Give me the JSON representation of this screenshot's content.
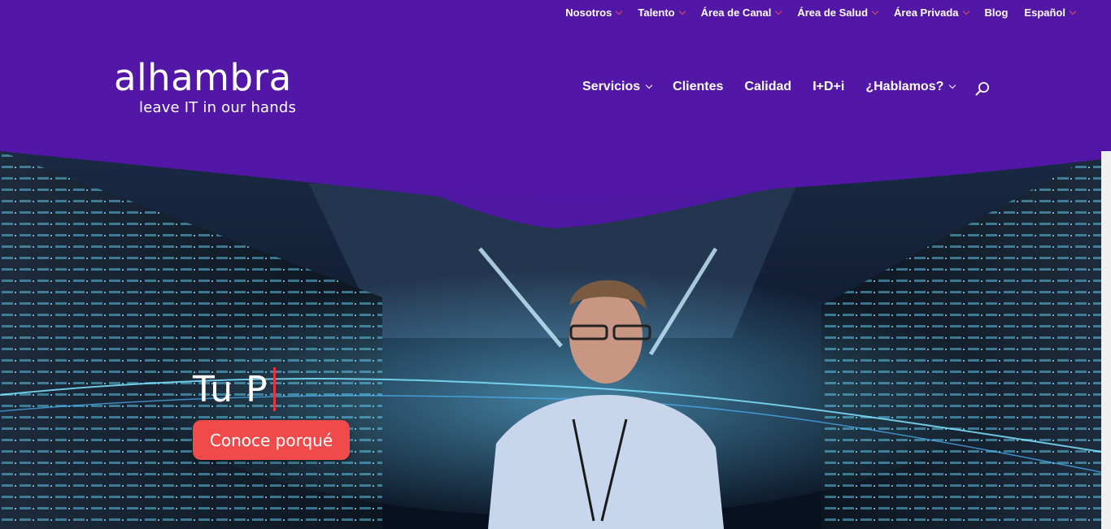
{
  "topnav": {
    "items": [
      {
        "label": "Nosotros",
        "has_dropdown": true
      },
      {
        "label": "Talento",
        "has_dropdown": true
      },
      {
        "label": "Área de Canal",
        "has_dropdown": true
      },
      {
        "label": "Área de Salud",
        "has_dropdown": true
      },
      {
        "label": "Área Privada",
        "has_dropdown": true
      },
      {
        "label": "Blog",
        "has_dropdown": false
      },
      {
        "label": "Español",
        "has_dropdown": true
      }
    ]
  },
  "logo": {
    "word": "alhambra",
    "tagline": "leave IT in our hands"
  },
  "mainnav": {
    "items": [
      {
        "label": "Servicios",
        "has_dropdown": true
      },
      {
        "label": "Clientes",
        "has_dropdown": false
      },
      {
        "label": "Calidad",
        "has_dropdown": false
      },
      {
        "label": "I+D+i",
        "has_dropdown": false
      },
      {
        "label": "¿Hablamos?",
        "has_dropdown": true
      }
    ],
    "search_icon": "search-icon"
  },
  "hero": {
    "typed_text": "Tu P",
    "cta_label": "Conoce porqué"
  },
  "colors": {
    "brand_purple": "#5217a6",
    "accent_red": "#f04a4a",
    "dropdown_chevron": "#e8505b"
  }
}
